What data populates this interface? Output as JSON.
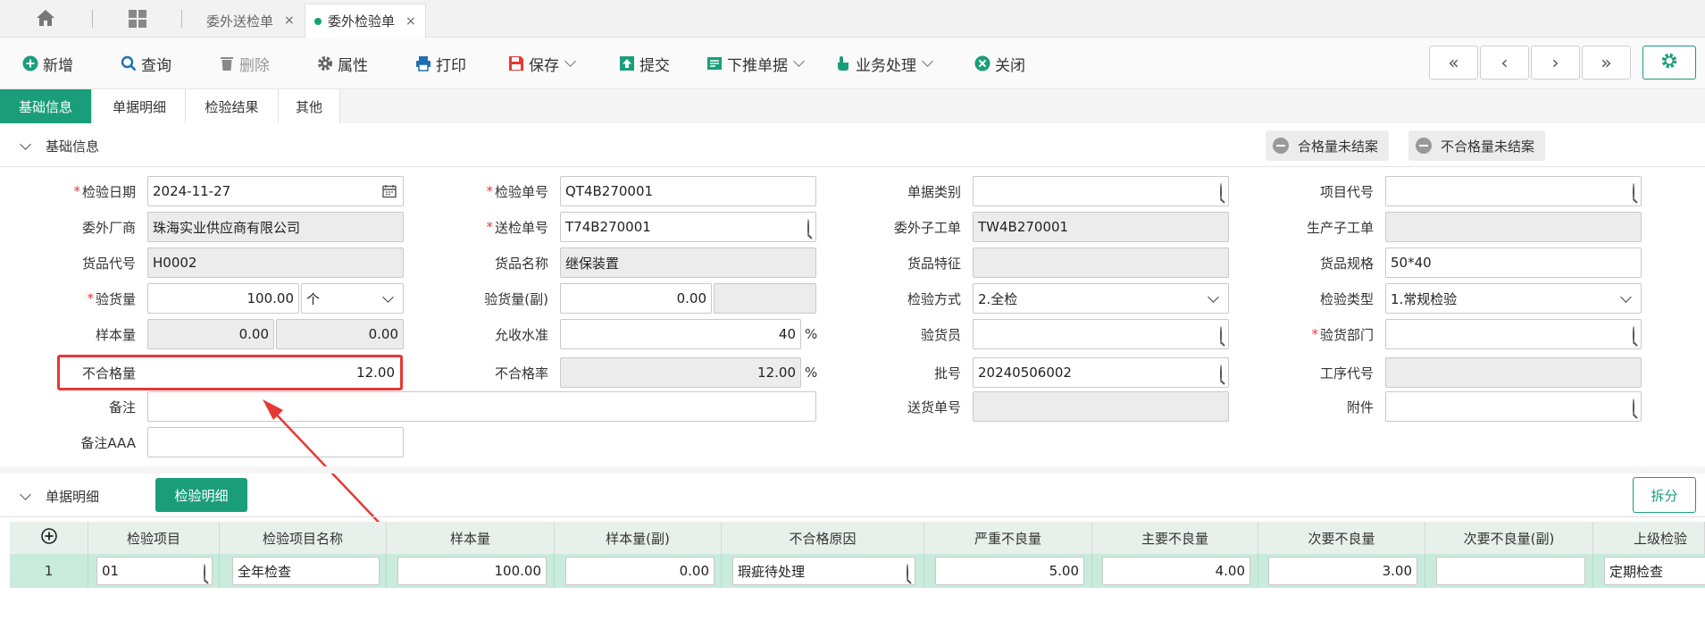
{
  "tabs": [
    {
      "label": "委外送检单",
      "close": "×"
    },
    {
      "label": "委外检验单",
      "close": "×"
    }
  ],
  "toolbar": {
    "new": "新增",
    "query": "查询",
    "delete": "删除",
    "properties": "属性",
    "print": "打印",
    "save": "保存",
    "submit": "提交",
    "push_down": "下推单据",
    "business": "业务处理",
    "close": "关闭"
  },
  "nav": {
    "first": "«",
    "prev": "‹",
    "next": "›",
    "last": "»"
  },
  "section_tabs": [
    "基础信息",
    "单据明细",
    "检验结果",
    "其他"
  ],
  "base_section": {
    "title": "基础信息",
    "btn_pass_unclosed": "合格量未结案",
    "btn_fail_unclosed": "不合格量未结案"
  },
  "form": {
    "inspect_date": {
      "label": "检验日期",
      "value": "2024-11-27"
    },
    "inspect_no": {
      "label": "检验单号",
      "value": "QT4B270001"
    },
    "doc_type": {
      "label": "单据类别",
      "value": ""
    },
    "project_code": {
      "label": "项目代号",
      "value": ""
    },
    "vendor": {
      "label": "委外厂商",
      "value": "珠海实业供应商有限公司"
    },
    "send_no": {
      "label": "送检单号",
      "value": "T74B270001"
    },
    "sub_order": {
      "label": "委外子工单",
      "value": "TW4B270001"
    },
    "prod_sub_order": {
      "label": "生产子工单",
      "value": ""
    },
    "goods_code": {
      "label": "货品代号",
      "value": "H0002"
    },
    "goods_name": {
      "label": "货品名称",
      "value": "继保装置"
    },
    "goods_feature": {
      "label": "货品特征",
      "value": ""
    },
    "goods_spec": {
      "label": "货品规格",
      "value": "50*40"
    },
    "inspect_qty": {
      "label": "验货量",
      "value": "100.00",
      "unit": "个"
    },
    "inspect_qty_sub": {
      "label": "验货量(副)",
      "value": "0.00",
      "unit": ""
    },
    "inspect_mode": {
      "label": "检验方式",
      "value": "2.全检"
    },
    "inspect_type": {
      "label": "检验类型",
      "value": "1.常规检验"
    },
    "sample_qty": {
      "label": "样本量",
      "value": "0.00",
      "value2": "0.00"
    },
    "accept_level": {
      "label": "允收水准",
      "value": "40",
      "unit": "%"
    },
    "inspector": {
      "label": "验货员",
      "value": ""
    },
    "inspect_dept": {
      "label": "验货部门",
      "value": ""
    },
    "fail_qty": {
      "label": "不合格量",
      "value": "12.00"
    },
    "fail_rate": {
      "label": "不合格率",
      "value": "12.00",
      "unit": "%"
    },
    "batch_no": {
      "label": "批号",
      "value": "20240506002"
    },
    "process_code": {
      "label": "工序代号",
      "value": ""
    },
    "remark": {
      "label": "备注",
      "value": ""
    },
    "delivery_no": {
      "label": "送货单号",
      "value": ""
    },
    "attachment": {
      "label": "附件",
      "value": ""
    },
    "remark_aaa": {
      "label": "备注AAA",
      "value": ""
    }
  },
  "detail": {
    "title": "单据明细",
    "tab": "检验明细",
    "split": "拆分",
    "columns": [
      "检验项目",
      "检验项目名称",
      "样本量",
      "样本量(副)",
      "不合格原因",
      "严重不良量",
      "主要不良量",
      "次要不良量",
      "次要不良量(副)",
      "上级检验"
    ],
    "row": {
      "no": "1",
      "item": "01",
      "item_name": "全年检查",
      "sample": "100.00",
      "sample_sub": "0.00",
      "reason": "瑕疵待处理",
      "severe": "5.00",
      "major": "4.00",
      "minor": "3.00",
      "minor_sub": "",
      "parent": "定期检查"
    }
  },
  "colors": {
    "accent": "#1a9e7a",
    "required": "#e53935",
    "highlight": "#e53935"
  }
}
